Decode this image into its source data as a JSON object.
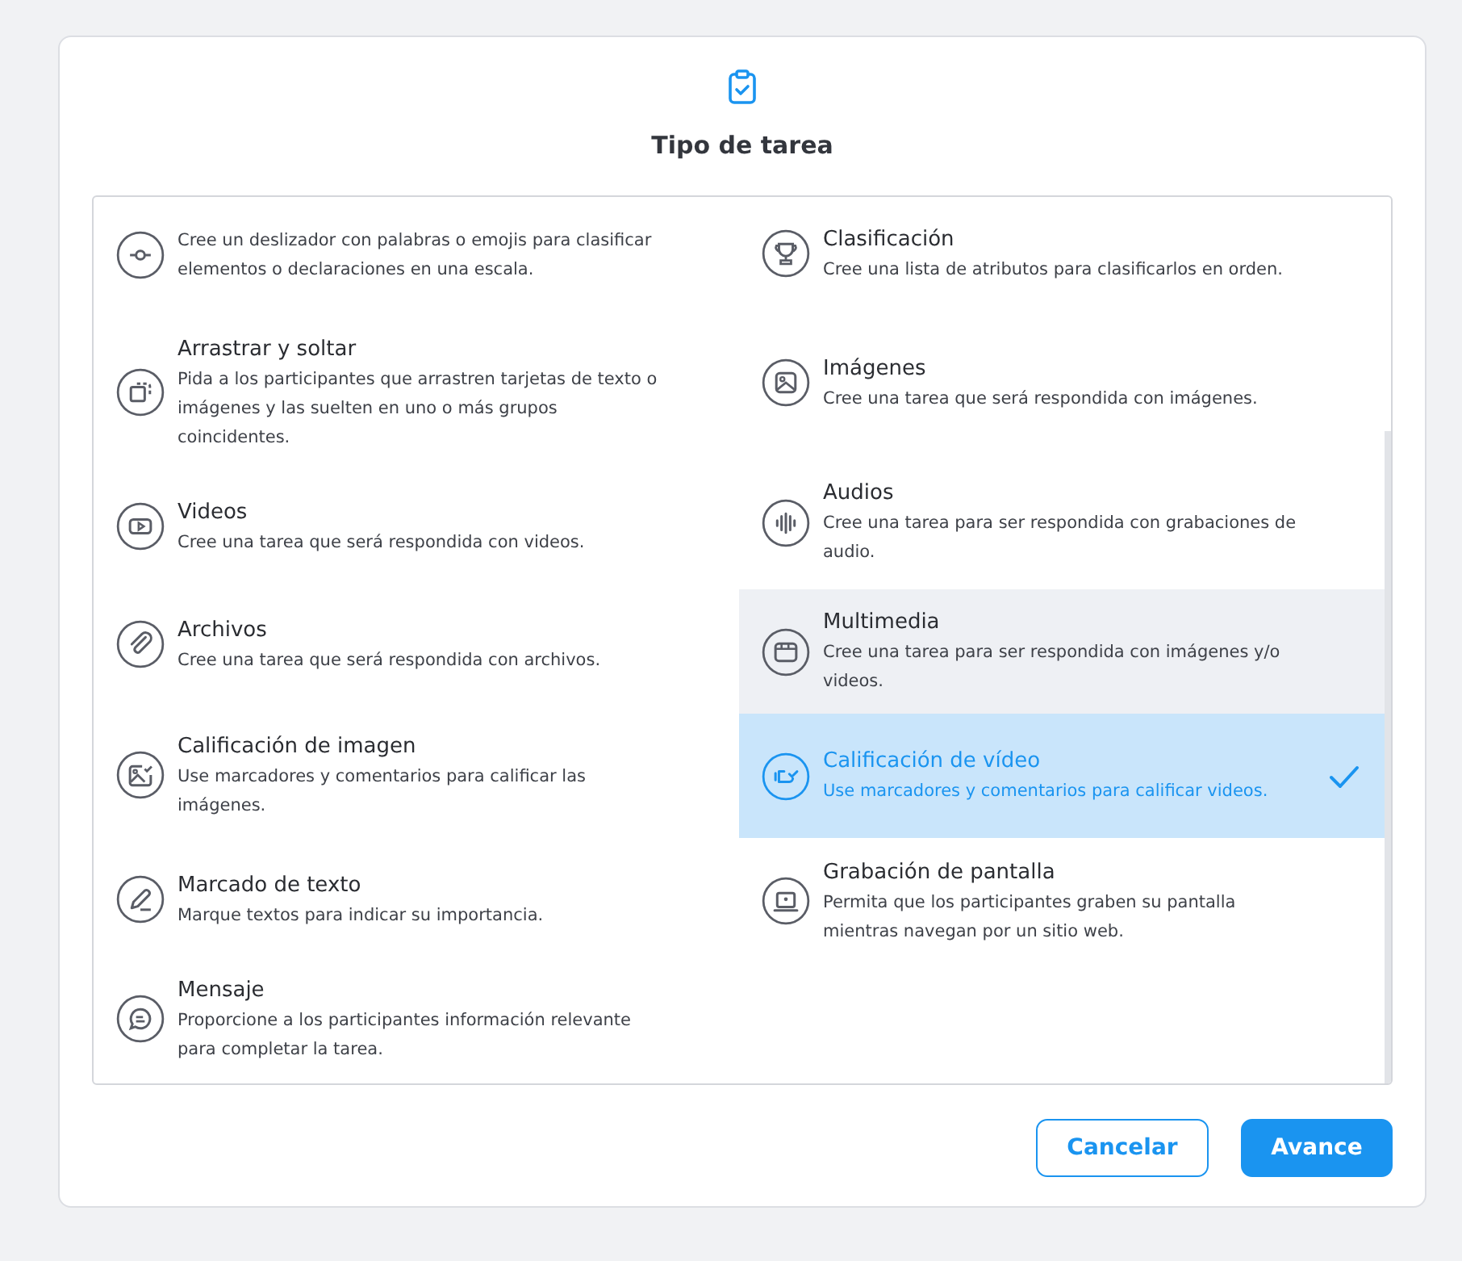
{
  "dialog": {
    "title": "Tipo de tarea"
  },
  "columns": [
    {
      "items": [
        {
          "description": "Cree un deslizador con palabras o emojis para clasificar elementos o declaraciones en una escala.",
          "selected": false,
          "highlighted": false
        },
        {
          "title": "Arrastrar y soltar",
          "description": "Pida a los participantes que arrastren tarjetas de texto o imágenes y las suelten en uno o más grupos coincidentes.",
          "selected": false,
          "highlighted": false
        },
        {
          "title": "Videos",
          "description": "Cree una tarea que será respondida con videos.",
          "selected": false,
          "highlighted": false
        },
        {
          "title": "Archivos",
          "description": "Cree una tarea que será respondida con archivos.",
          "selected": false,
          "highlighted": false
        },
        {
          "title": "Calificación de imagen",
          "description": "Use marcadores y comentarios para calificar las imágenes.",
          "selected": false,
          "highlighted": false
        },
        {
          "title": "Marcado de texto",
          "description": "Marque textos para indicar su importancia.",
          "selected": false,
          "highlighted": false
        },
        {
          "title": "Mensaje",
          "description": "Proporcione a los participantes información relevante para completar la tarea.",
          "selected": false,
          "highlighted": false
        }
      ]
    },
    {
      "items": [
        {
          "title": "Clasificación",
          "description": "Cree una lista de atributos para clasificarlos en orden.",
          "selected": false,
          "highlighted": false
        },
        {
          "title": "Imágenes",
          "description": "Cree una tarea que será respondida con imágenes.",
          "selected": false,
          "highlighted": false
        },
        {
          "title": "Audios",
          "description": "Cree una tarea para ser respondida con grabaciones de audio.",
          "selected": false,
          "highlighted": false
        },
        {
          "title": "Multimedia",
          "description": "Cree una tarea para ser respondida con imágenes y/o videos.",
          "selected": false,
          "highlighted": true
        },
        {
          "title": "Calificación de vídeo",
          "description": "Use marcadores y comentarios para calificar videos.",
          "selected": true,
          "highlighted": false
        },
        {
          "title": "Grabación de pantalla",
          "description": "Permita que los participantes graben su pantalla mientras navegan por un sitio web.",
          "selected": false,
          "highlighted": false
        }
      ]
    }
  ],
  "buttons": [
    {
      "label": "Cancelar",
      "kind": "secondary"
    },
    {
      "label": "Avance",
      "kind": "primary"
    }
  ]
}
